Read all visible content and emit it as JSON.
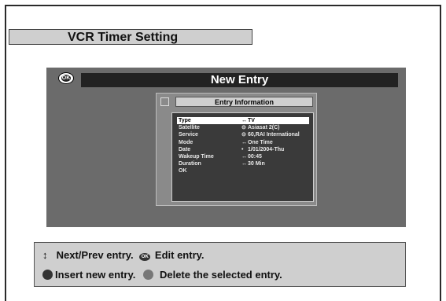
{
  "page_title": "VCR Timer Setting",
  "screen": {
    "title": "New Entry",
    "ok_badge": "OK",
    "dialog_title": "Entry Information",
    "rows": [
      {
        "label": "Type",
        "icon": "↔",
        "value": "TV",
        "selected": true
      },
      {
        "label": "Satellite",
        "icon": "⊝",
        "value": "Asiasat 2(C)"
      },
      {
        "label": "Service",
        "icon": "⊝",
        "value": "60,RAI International"
      },
      {
        "label": "Mode",
        "icon": "↔",
        "value": "One Time"
      },
      {
        "label": "Date",
        "icon": "•",
        "value": "1/01/2004-Thu"
      },
      {
        "label": "Wakeup Time",
        "icon": "↔",
        "value": "00:45"
      },
      {
        "label": "Duration",
        "icon": "↔",
        "value": "30 Min"
      },
      {
        "label": "OK",
        "icon": "",
        "value": ""
      }
    ]
  },
  "help": {
    "line1_a": "Next/Prev entry.",
    "line1_ok": "OK",
    "line1_b": "Edit entry.",
    "line2_a": "Insert new entry.",
    "line2_b": "Delete the selected entry."
  },
  "colors": {
    "background": "#6b6b6b",
    "titlebar": "#222222",
    "help_bg": "#cfcfcf"
  }
}
